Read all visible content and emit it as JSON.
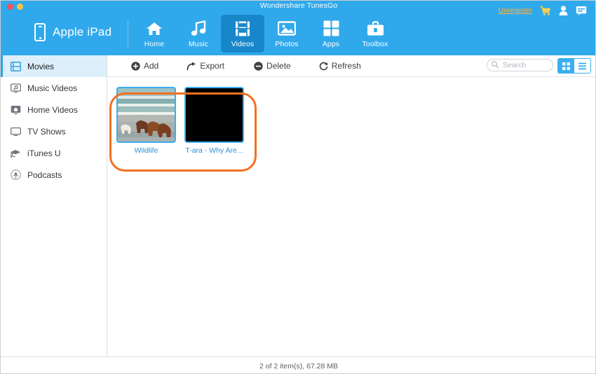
{
  "window": {
    "title": "Wondershare TunesGo",
    "traffic_lights": [
      "close",
      "minimize"
    ]
  },
  "header": {
    "device_name": "Apple iPad",
    "device_icon": "iphone-icon",
    "unregister_label": "Unregister",
    "right_icons": [
      "cart-icon",
      "account-icon",
      "feedback-icon"
    ],
    "tabs": [
      {
        "label": "Home",
        "icon": "home-icon",
        "active": false
      },
      {
        "label": "Music",
        "icon": "music-icon",
        "active": false
      },
      {
        "label": "Videos",
        "icon": "video-icon",
        "active": true
      },
      {
        "label": "Photos",
        "icon": "photo-icon",
        "active": false
      },
      {
        "label": "Apps",
        "icon": "apps-icon",
        "active": false
      },
      {
        "label": "Toolbox",
        "icon": "toolbox-icon",
        "active": false
      }
    ]
  },
  "sidebar": {
    "items": [
      {
        "label": "Movies",
        "icon": "movies-icon",
        "active": true
      },
      {
        "label": "Music Videos",
        "icon": "music-video-icon",
        "active": false
      },
      {
        "label": "Home Videos",
        "icon": "home-video-icon",
        "active": false
      },
      {
        "label": "TV Shows",
        "icon": "tv-icon",
        "active": false
      },
      {
        "label": "iTunes U",
        "icon": "graduation-icon",
        "active": false
      },
      {
        "label": "Podcasts",
        "icon": "podcast-icon",
        "active": false
      }
    ]
  },
  "toolbar": {
    "add_label": "Add",
    "export_label": "Export",
    "delete_label": "Delete",
    "refresh_label": "Refresh",
    "search_placeholder": "Search",
    "search_value": "",
    "search_icon": "search-icon",
    "view_modes": [
      {
        "name": "grid-view",
        "active": true
      },
      {
        "name": "list-view",
        "active": false
      }
    ]
  },
  "videos": [
    {
      "title": "Wildlife",
      "thumbnail": "beach-horses",
      "selected": true
    },
    {
      "title": "T-ara - Why Are...",
      "thumbnail": "black",
      "selected": true
    }
  ],
  "status": {
    "text": "2 of 2 item(s), 67.28 MB"
  },
  "colors": {
    "header_blue": "#30a9ec",
    "active_tab_blue": "#1887c9",
    "accent_blue": "#3aaef0",
    "annotation_orange": "#f4701f",
    "unregister_orange": "#ffb33e"
  }
}
